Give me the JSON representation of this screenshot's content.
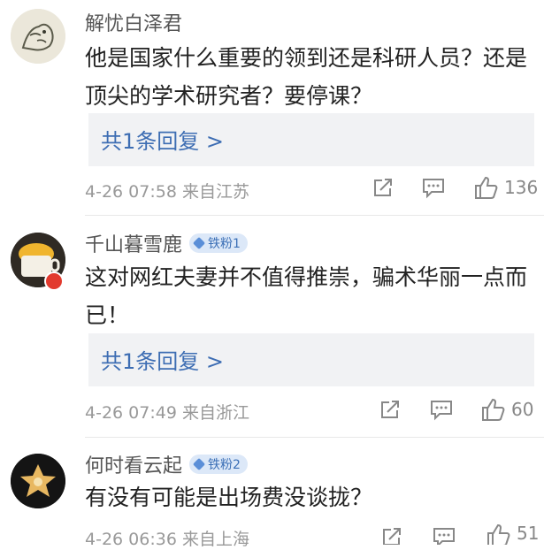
{
  "comments": [
    {
      "username": "解忧白泽君",
      "badge": "",
      "text_lines": [
        "他是国家什么重要的领到还是科研人员？还是",
        "顶尖的学术研究者？要停课？"
      ],
      "reply": "共1条回复 >",
      "timestamp": "4-26 07:58",
      "location": "来自江苏",
      "likes": "136"
    },
    {
      "username": "千山暮雪鹿",
      "badge": "铁粉1",
      "text_lines": [
        "这对网红夫妻并不值得推崇，骗术华丽一点而",
        "已！"
      ],
      "reply": "共1条回复 >",
      "timestamp": "4-26 07:49",
      "location": "来自浙江",
      "likes": "60"
    },
    {
      "username": "何时看云起",
      "badge": "铁粉2",
      "text_lines": [
        "有没有可能是出场费没谈拢？"
      ],
      "reply": "",
      "timestamp": "4-26 06:36",
      "location": "来自上海",
      "likes": "51"
    }
  ],
  "colors": {
    "link": "#3d6db3",
    "meta": "#999999",
    "badge_bg": "#dce8f8"
  }
}
